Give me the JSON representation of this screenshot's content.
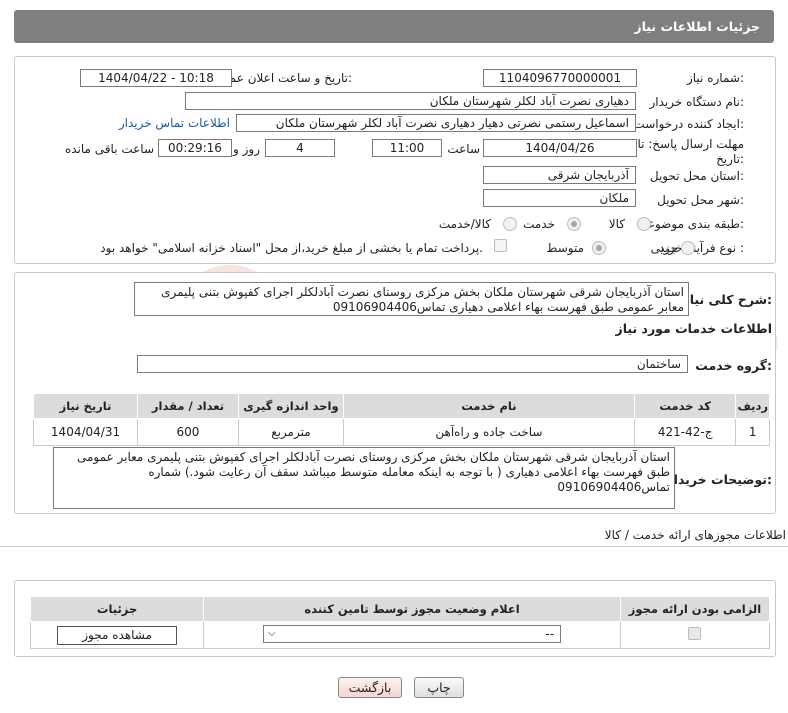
{
  "header": {
    "title": "جزئیات اطلاعات نیاز"
  },
  "fields": {
    "need_number_label": "شماره نیاز:",
    "need_number": "1104096770000001",
    "announce_label": "تاریخ و ساعت اعلان عمومی:",
    "announce_value": "1404/04/22 - 10:18",
    "buyer_org_label": "نام دستگاه خریدار:",
    "buyer_org": "دهیاری نصرت آباد لکلر شهرستان ملکان",
    "creator_label": "ایجاد کننده درخواست:",
    "creator": "اسماعیل رستمی نصرتی دهیار دهیاری نصرت آباد لکلر شهرستان ملکان",
    "contact_link": "اطلاعات تماس خریدار",
    "deadline_label_1": "مهلت ارسال پاسخ: تا",
    "deadline_label_2": "تاریخ:",
    "deadline_date": "1404/04/26",
    "time_label": "ساعت",
    "deadline_time": "11:00",
    "days_value": "4",
    "days_label": "روز و",
    "remaining_time": "00:29:16",
    "remaining_label": "ساعت باقی مانده",
    "province_label": "استان محل تحویل:",
    "province": "آذربایجان شرقی",
    "city_label": "شهر محل تحویل:",
    "city": "ملکان",
    "category_label": "طبقه بندی موضوعی:",
    "cat_goods": "کالا",
    "cat_service": "خدمت",
    "cat_both": "کالا/خدمت",
    "purchase_type_label": "نوع فرآیند خرید :",
    "pt_partial": "جزیی",
    "pt_medium": "متوسط",
    "payment_note": "پرداخت تمام یا بخشی از مبلغ خرید،از محل \"اسناد خزانه اسلامی\" خواهد بود."
  },
  "description": {
    "label": "شرح کلی نیاز:",
    "text": "استان آذربایجان شرقی شهرستان ملکان بخش مرکزی روستای نصرت آبادلکلر اجرای کفپوش بتنی پلیمری معابر عمومی طبق فهرست بهاء اعلامی دهیاری تماس09106904406"
  },
  "services": {
    "section_title": "اطلاعات خدمات مورد نیاز",
    "group_label": "گروه خدمت:",
    "group_value": "ساختمان",
    "columns": [
      "ردیف",
      "کد خدمت",
      "نام خدمت",
      "واحد اندازه گیری",
      "تعداد / مقدار",
      "تاریخ نیاز"
    ],
    "rows": [
      [
        "1",
        "ج-42-421",
        "ساخت جاده و راه‌آهن",
        "مترمربع",
        "600",
        "1404/04/31"
      ]
    ]
  },
  "buyer_notes": {
    "label": "توضیحات خریدار:",
    "text": "استان آذربایجان شرقی شهرستان ملکان بخش مرکزی روستای نصرت آبادلکلر اجرای کفپوش بتنی پلیمری معابر عمومی طبق فهرست بهاء اعلامی دهیاری ( با توجه به اینکه معامله متوسط میباشد سقف آن رعایت شود.) شماره تماس09106904406"
  },
  "permits": {
    "section_title": "اطلاعات مجوزهای ارائه خدمت / کالا",
    "columns": [
      "الزامی بودن ارائه مجوز",
      "اعلام وضعیت مجوز توسط تامین کننده",
      "جزئیات"
    ],
    "select_value": "--",
    "view_button": "مشاهده مجوز"
  },
  "buttons": {
    "print": "چاپ",
    "back": "بازگشت"
  },
  "watermark": "AriaTender.net"
}
